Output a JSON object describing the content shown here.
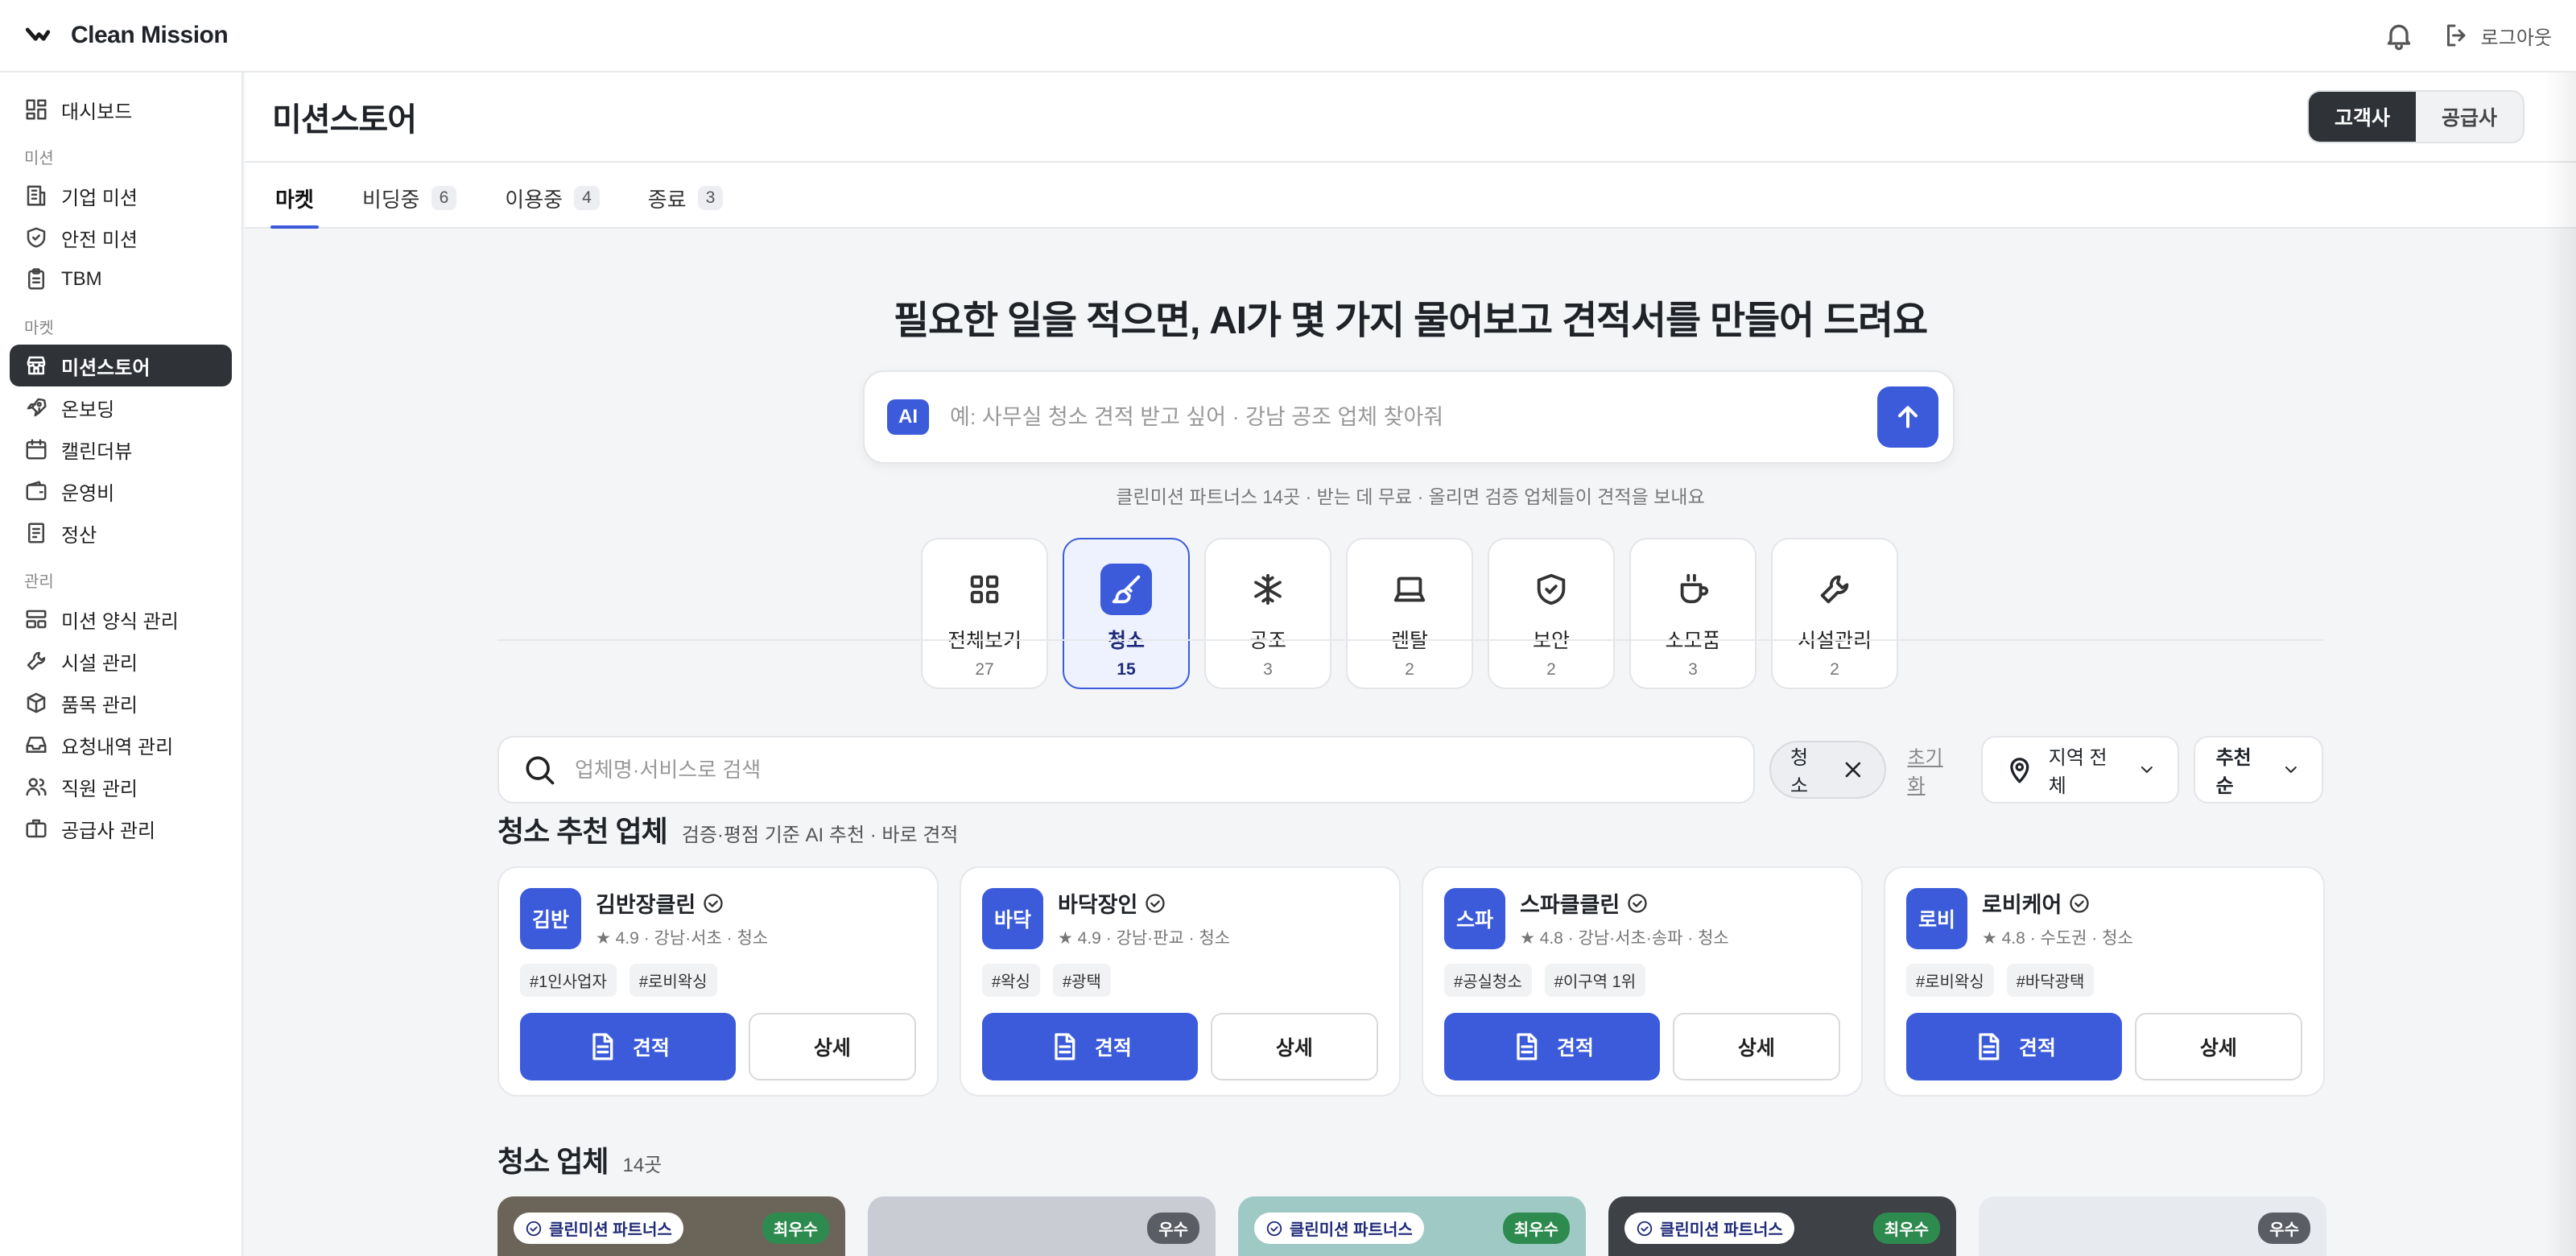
{
  "app": {
    "title": "Clean Mission"
  },
  "topbar": {
    "logout_label": "로그아웃"
  },
  "sidebar": {
    "items_top": [
      {
        "label": "대시보드",
        "icon": "dashboard-icon"
      }
    ],
    "sections": [
      {
        "title": "미션",
        "items": [
          {
            "label": "기업 미션",
            "icon": "building-icon"
          },
          {
            "label": "안전 미션",
            "icon": "shield-check-icon"
          },
          {
            "label": "TBM",
            "icon": "clipboard-icon"
          }
        ]
      },
      {
        "title": "마켓",
        "items": [
          {
            "label": "미션스토어",
            "icon": "store-icon",
            "active": true
          },
          {
            "label": "온보딩",
            "icon": "rocket-icon"
          },
          {
            "label": "캘린더뷰",
            "icon": "calendar-icon"
          },
          {
            "label": "운영비",
            "icon": "wallet-icon"
          },
          {
            "label": "정산",
            "icon": "receipt-icon"
          }
        ]
      },
      {
        "title": "관리",
        "items": [
          {
            "label": "미션 양식 관리",
            "icon": "layout-icon"
          },
          {
            "label": "시설 관리",
            "icon": "wrench-icon"
          },
          {
            "label": "품목 관리",
            "icon": "box-icon"
          },
          {
            "label": "요청내역 관리",
            "icon": "inbox-icon"
          },
          {
            "label": "직원 관리",
            "icon": "users-icon"
          },
          {
            "label": "공급사 관리",
            "icon": "briefcase-icon"
          }
        ]
      }
    ]
  },
  "page": {
    "title": "미션스토어",
    "roles": [
      {
        "label": "고객사",
        "active": true
      },
      {
        "label": "공급사",
        "active": false
      }
    ],
    "tabs": [
      {
        "label": "마켓",
        "count": "",
        "active": true
      },
      {
        "label": "비딩중",
        "count": "6"
      },
      {
        "label": "이용중",
        "count": "4"
      },
      {
        "label": "종료",
        "count": "3"
      }
    ]
  },
  "hero": {
    "title": "필요한 일을 적으면, AI가 몇 가지 물어보고 견적서를 만들어 드려요",
    "ai_badge": "AI",
    "placeholder": "예: 사무실 청소 견적 받고 싶어 · 강남 공조 업체 찾아줘",
    "subtitle": "클린미션 파트너스 14곳 · 받는 데 무료 · 올리면 검증 업체들이 견적을 보내요"
  },
  "categories": [
    {
      "label": "전체보기",
      "count": "27",
      "icon": "grid-icon"
    },
    {
      "label": "청소",
      "count": "15",
      "icon": "brush-icon",
      "active": true
    },
    {
      "label": "공조",
      "count": "3",
      "icon": "snowflake-icon"
    },
    {
      "label": "렌탈",
      "count": "2",
      "icon": "laptop-icon"
    },
    {
      "label": "보안",
      "count": "2",
      "icon": "shield-check-icon"
    },
    {
      "label": "소모품",
      "count": "3",
      "icon": "cup-icon"
    },
    {
      "label": "시설관리",
      "count": "2",
      "icon": "wrench-icon"
    }
  ],
  "filters": {
    "search_placeholder": "업체명·서비스로 검색",
    "active_chip": "청소",
    "reset_label": "초기화",
    "region_label": "지역 전체",
    "sort_label": "추천순"
  },
  "recommended": {
    "title": "청소 추천 업체",
    "subtitle": "검증·평점 기준 AI 추천 · 바로 견적",
    "quote_label": "견적",
    "detail_label": "상세",
    "vendors": [
      {
        "logo": "김반",
        "name": "김반장클린",
        "meta": "★ 4.9 · 강남·서초 · 청소",
        "tags": [
          "#1인사업자",
          "#로비왁싱"
        ]
      },
      {
        "logo": "바닥",
        "name": "바닥장인",
        "meta": "★ 4.9 · 강남·판교 · 청소",
        "tags": [
          "#왁싱",
          "#광택"
        ]
      },
      {
        "logo": "스파",
        "name": "스파클클린",
        "meta": "★ 4.8 · 강남·서초·송파 · 청소",
        "tags": [
          "#공실청소",
          "#이구역 1위"
        ]
      },
      {
        "logo": "로비",
        "name": "로비케어",
        "meta": "★ 4.8 · 수도권 · 청소",
        "tags": [
          "#로비왁싱",
          "#바닥광택"
        ]
      }
    ]
  },
  "vendors_section": {
    "title": "청소 업체",
    "count": "14곳",
    "partner_label": "클린미션 파트너스",
    "cards": [
      {
        "partner": true,
        "grade": "최우수",
        "bg": "#6b6459"
      },
      {
        "partner": false,
        "grade": "우수",
        "bg": "#c9cdd3"
      },
      {
        "partner": true,
        "grade": "최우수",
        "bg": "#9fc9c4"
      },
      {
        "partner": true,
        "grade": "최우수",
        "bg": "#3e4146"
      },
      {
        "partner": false,
        "grade": "우수",
        "bg": "#e7ebf0"
      }
    ]
  },
  "colors": {
    "accent": "#3b5bdb",
    "dark": "#2f3237",
    "best": "#2e8b4f"
  }
}
